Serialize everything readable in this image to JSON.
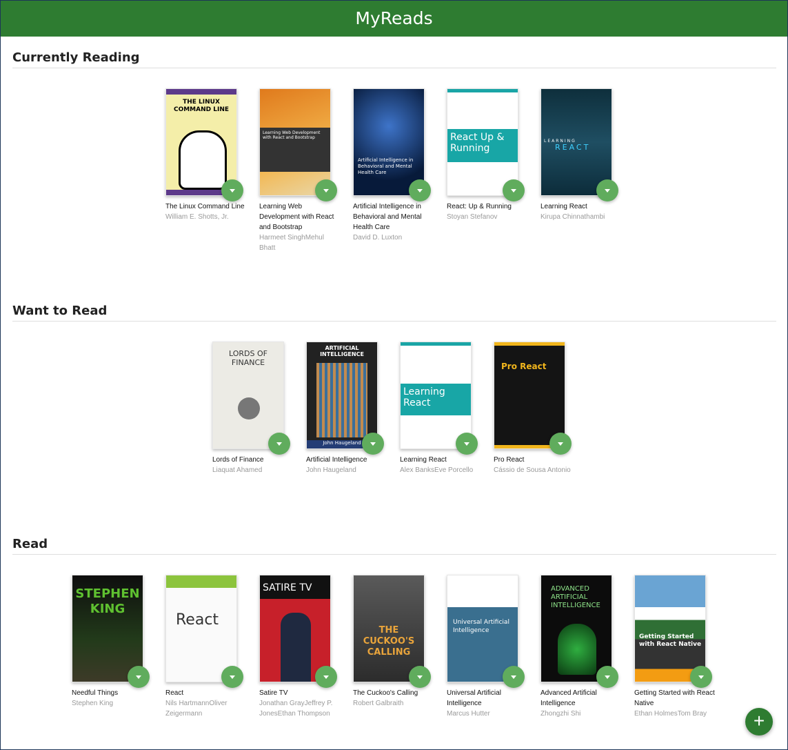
{
  "app": {
    "title": "MyReads"
  },
  "shelves": [
    {
      "title": "Currently Reading",
      "books": [
        {
          "title": "The Linux Command Line",
          "authors": "William E. Shotts, Jr."
        },
        {
          "title": "Learning Web Development with React and Bootstrap",
          "authors": "Harmeet SinghMehul Bhatt"
        },
        {
          "title": "Artificial Intelligence in Behavioral and Mental Health Care",
          "authors": "David D. Luxton"
        },
        {
          "title": "React: Up & Running",
          "authors": "Stoyan Stefanov"
        },
        {
          "title": "Learning React",
          "authors": "Kirupa Chinnathambi"
        }
      ]
    },
    {
      "title": "Want to Read",
      "books": [
        {
          "title": "Lords of Finance",
          "authors": "Liaquat Ahamed"
        },
        {
          "title": "Artificial Intelligence",
          "authors": "John Haugeland"
        },
        {
          "title": "Learning React",
          "authors": "Alex BanksEve Porcello"
        },
        {
          "title": "Pro React",
          "authors": "Cássio de Sousa Antonio"
        }
      ]
    },
    {
      "title": "Read",
      "books": [
        {
          "title": "Needful Things",
          "authors": "Stephen King"
        },
        {
          "title": "React",
          "authors": "Nils HartmannOliver Zeigermann"
        },
        {
          "title": "Satire TV",
          "authors": "Jonathan GrayJeffrey P. JonesEthan Thompson"
        },
        {
          "title": "The Cuckoo's Calling",
          "authors": "Robert Galbraith"
        },
        {
          "title": "Universal Artificial Intelligence",
          "authors": "Marcus Hutter"
        },
        {
          "title": "Advanced Artificial Intelligence",
          "authors": "Zhongzhi Shi"
        },
        {
          "title": "Getting Started with React Native",
          "authors": "Ethan HolmesTom Bray"
        }
      ]
    }
  ],
  "covers": {
    "linux": "THE LINUX COMMAND LINE",
    "web": "Learning Web Development with React and Bootstrap",
    "ai": "Artificial Intelligence in Behavioral and Mental Health Care",
    "react": "React Up & Running",
    "lr_a": "LEARNING",
    "lr_b": "REACT",
    "lords": "LORDS OF FINANCE",
    "aibook": "ARTIFICIAL INTELLIGENCE",
    "aibook_author": "John Haugeland",
    "learning_react": "Learning React",
    "pro": "Pro React",
    "king": "STEPHEN KING",
    "react2": "React",
    "satire": "SATIRE TV",
    "cuckoo": "THE CUCKOO'S CALLING",
    "univ": "Universal Artificial Intelligence",
    "adv": "ADVANCED ARTIFICIAL INTELLIGENCE",
    "start": "Getting Started with React Native"
  },
  "fab": {
    "label": "+"
  },
  "colors": {
    "header": "#2e7c31",
    "changer": "#60ac5d"
  },
  "icons": {
    "changer": "triangle-down-icon",
    "add": "plus-icon"
  }
}
